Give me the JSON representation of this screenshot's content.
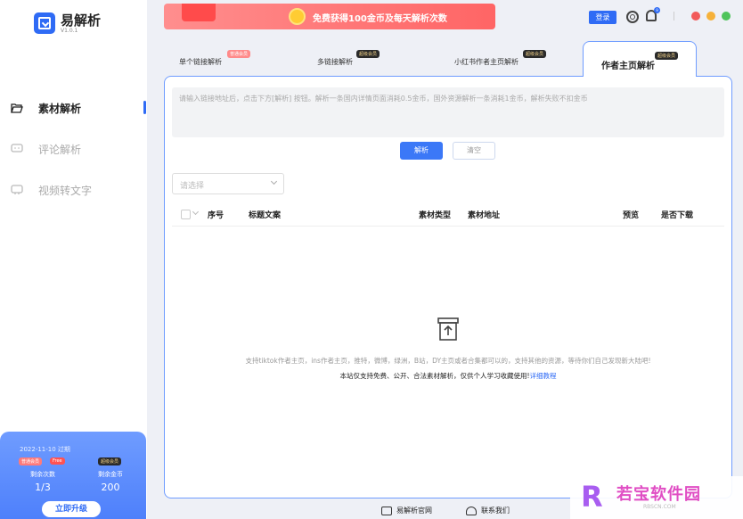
{
  "app": {
    "name": "易解析",
    "version": "V1.0.1"
  },
  "sidebar": {
    "items": [
      {
        "label": "素材解析",
        "icon": "folder-open-icon",
        "active": true
      },
      {
        "label": "评论解析",
        "icon": "comment-icon",
        "active": false
      },
      {
        "label": "视频转文字",
        "icon": "video-text-icon",
        "active": false
      }
    ],
    "promo": {
      "expire": "2022-11-10 过期",
      "badge_normal": "普通会员",
      "badge_free": "Free",
      "badge_super": "超级会员",
      "remaining_label": "剩余次数",
      "remaining_value": "1/3",
      "coins_label": "剩余金币",
      "coins_value": "200",
      "upgrade_label": "立即升级"
    }
  },
  "header": {
    "banner_text": "免费获得100金币及每天解析次数",
    "login_label": "登录",
    "bell_count": "9"
  },
  "tabs": [
    {
      "label": "单个链接解析",
      "badge": "普通会员"
    },
    {
      "label": "多链接解析",
      "badge": "超级会员"
    },
    {
      "label": "小红书作者主页解析",
      "badge": "超级会员"
    },
    {
      "label": "作者主页解析",
      "badge": "超级会员",
      "active": true
    }
  ],
  "main": {
    "input_placeholder": "请输入链接地址后，点击下方[解析] 按钮。解析一条国内详情页面消耗0.5金币，国外资源解析一条消耗1金币，解析失败不扣金币",
    "parse_label": "解析",
    "clear_label": "清空",
    "select_placeholder": "请选择",
    "table": {
      "columns": [
        "序号",
        "标题文案",
        "素材类型",
        "素材地址",
        "预览",
        "是否下载"
      ]
    },
    "empty_text": "支持tiktok作者主页，ins作者主页，推特，微博，绿洲，B站，DY主页或者合集都可以的，支持其他的资源，等待你们自己发现新大陆吧!",
    "notice_text": "本站仅支持免费、公开、合法素材解析，仅供个人学习收藏使用!",
    "notice_link": "详细教程"
  },
  "footer": {
    "site_label": "易解析官网",
    "contact_label": "联系我们"
  },
  "watermark": {
    "logo": "R",
    "text": "若宝软件园",
    "sub": "RBSCN.COM"
  },
  "colors": {
    "accent": "#2f6bf5",
    "banner": "#ff6b6b",
    "panel_border": "#6f9cff"
  }
}
